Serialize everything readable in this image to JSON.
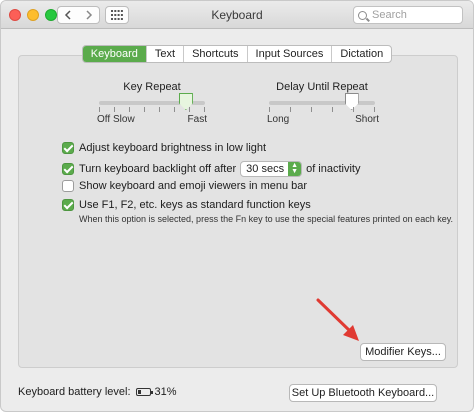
{
  "window": {
    "title": "Keyboard"
  },
  "search": {
    "placeholder": "Search"
  },
  "tabs": [
    {
      "label": "Keyboard",
      "active": true
    },
    {
      "label": "Text",
      "active": false
    },
    {
      "label": "Shortcuts",
      "active": false
    },
    {
      "label": "Input Sources",
      "active": false
    },
    {
      "label": "Dictation",
      "active": false
    }
  ],
  "key_repeat": {
    "label": "Key Repeat",
    "ends": [
      "Off",
      "Slow",
      "Fast"
    ],
    "level": 0.82
  },
  "delay_repeat": {
    "label": "Delay Until Repeat",
    "ends": [
      "Long",
      "Short"
    ],
    "level": 0.78
  },
  "checkboxes": {
    "brightness": {
      "label": "Adjust keyboard brightness in low light",
      "checked": true
    },
    "backlight": {
      "label_before": "Turn keyboard backlight off after",
      "select_value": "30 secs",
      "label_after": "of inactivity",
      "checked": true
    },
    "viewers": {
      "label": "Show keyboard and emoji viewers in menu bar",
      "checked": false
    },
    "fn_keys": {
      "label": "Use F1, F2, etc. keys as standard function keys",
      "checked": true
    }
  },
  "fn_hint": "When this option is selected, press the Fn key to use the special features printed on each key.",
  "buttons": {
    "modifier": "Modifier Keys...",
    "bluetooth": "Set Up Bluetooth Keyboard..."
  },
  "battery": {
    "label": "Keyboard battery level:",
    "percent_text": "31%",
    "level": 0.31
  },
  "colors": {
    "accent": "#5bab4c",
    "arrow": "#e03a32"
  },
  "icons": [
    "back-chevron-icon",
    "forward-chevron-icon",
    "grid-icon",
    "search-icon",
    "battery-icon",
    "arrow-pointer-icon"
  ]
}
